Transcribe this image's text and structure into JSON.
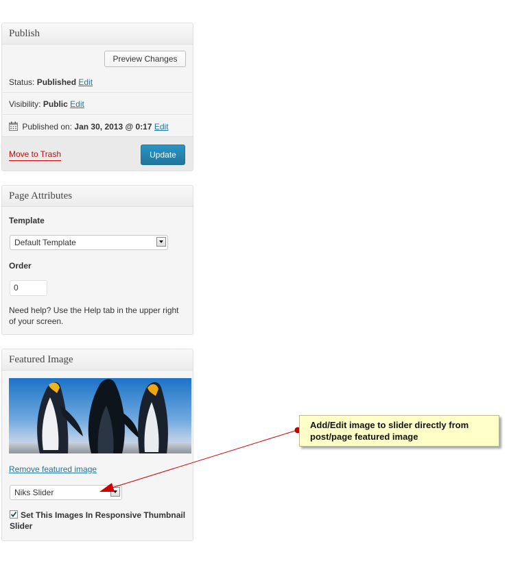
{
  "publish": {
    "title": "Publish",
    "preview_label": "Preview Changes",
    "status_label": "Status:",
    "status_value": "Published",
    "visibility_label": "Visibility:",
    "visibility_value": "Public",
    "published_on_label": "Published on:",
    "published_on_value": "Jan 30, 2013 @ 0:17",
    "edit_label": "Edit",
    "trash_label": "Move to Trash",
    "update_label": "Update"
  },
  "page_attributes": {
    "title": "Page Attributes",
    "template_label": "Template",
    "template_selected": "Default Template",
    "order_label": "Order",
    "order_value": "0",
    "help_line1": "Need help? Use the Help tab in the upper right",
    "help_line2": "of your screen."
  },
  "featured_image": {
    "title": "Featured Image",
    "remove_label": "Remove featured image",
    "slider_selected": "Niks Slider",
    "checkbox_checked": true,
    "checkbox_line1": "Set This Images In Responsive Thumbnail",
    "checkbox_line2": "Slider"
  },
  "annotation": {
    "line1": "Add/Edit image to slider directly from",
    "line2": "post/page featured image"
  },
  "colors": {
    "link": "#21759b",
    "trash": "#bc0b0b",
    "primary": "#21759b",
    "arrow": "#d00000",
    "callout_bg": "#ffffc8"
  }
}
